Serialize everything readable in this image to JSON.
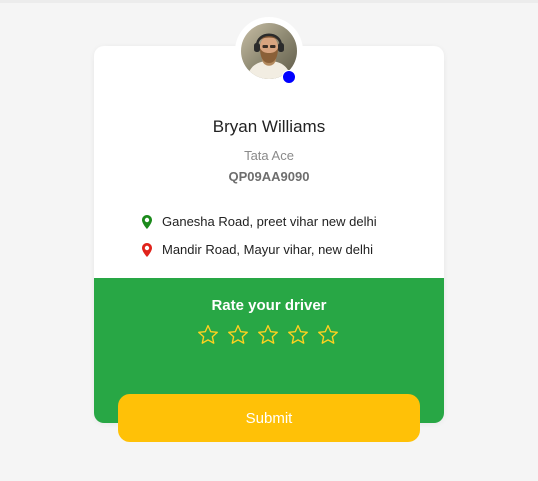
{
  "driver": {
    "name": "Bryan Williams",
    "vehicle": "Tata Ace",
    "plate": "QP09AA9090",
    "status_color": "#0000ff"
  },
  "locations": [
    {
      "label": "Ganesha Road, preet vihar new delhi",
      "icon": "map-pin-icon",
      "color": "#1b8a1b"
    },
    {
      "label": "Mandir Road, Mayur vihar, new delhi",
      "icon": "map-pin-icon",
      "color": "#e0231b"
    }
  ],
  "rating": {
    "title": "Rate your driver",
    "max_stars": 5,
    "selected": 0,
    "panel_color": "#28a745",
    "star_color": "#ffd21f"
  },
  "submit": {
    "label": "Submit",
    "color": "#ffc107"
  }
}
